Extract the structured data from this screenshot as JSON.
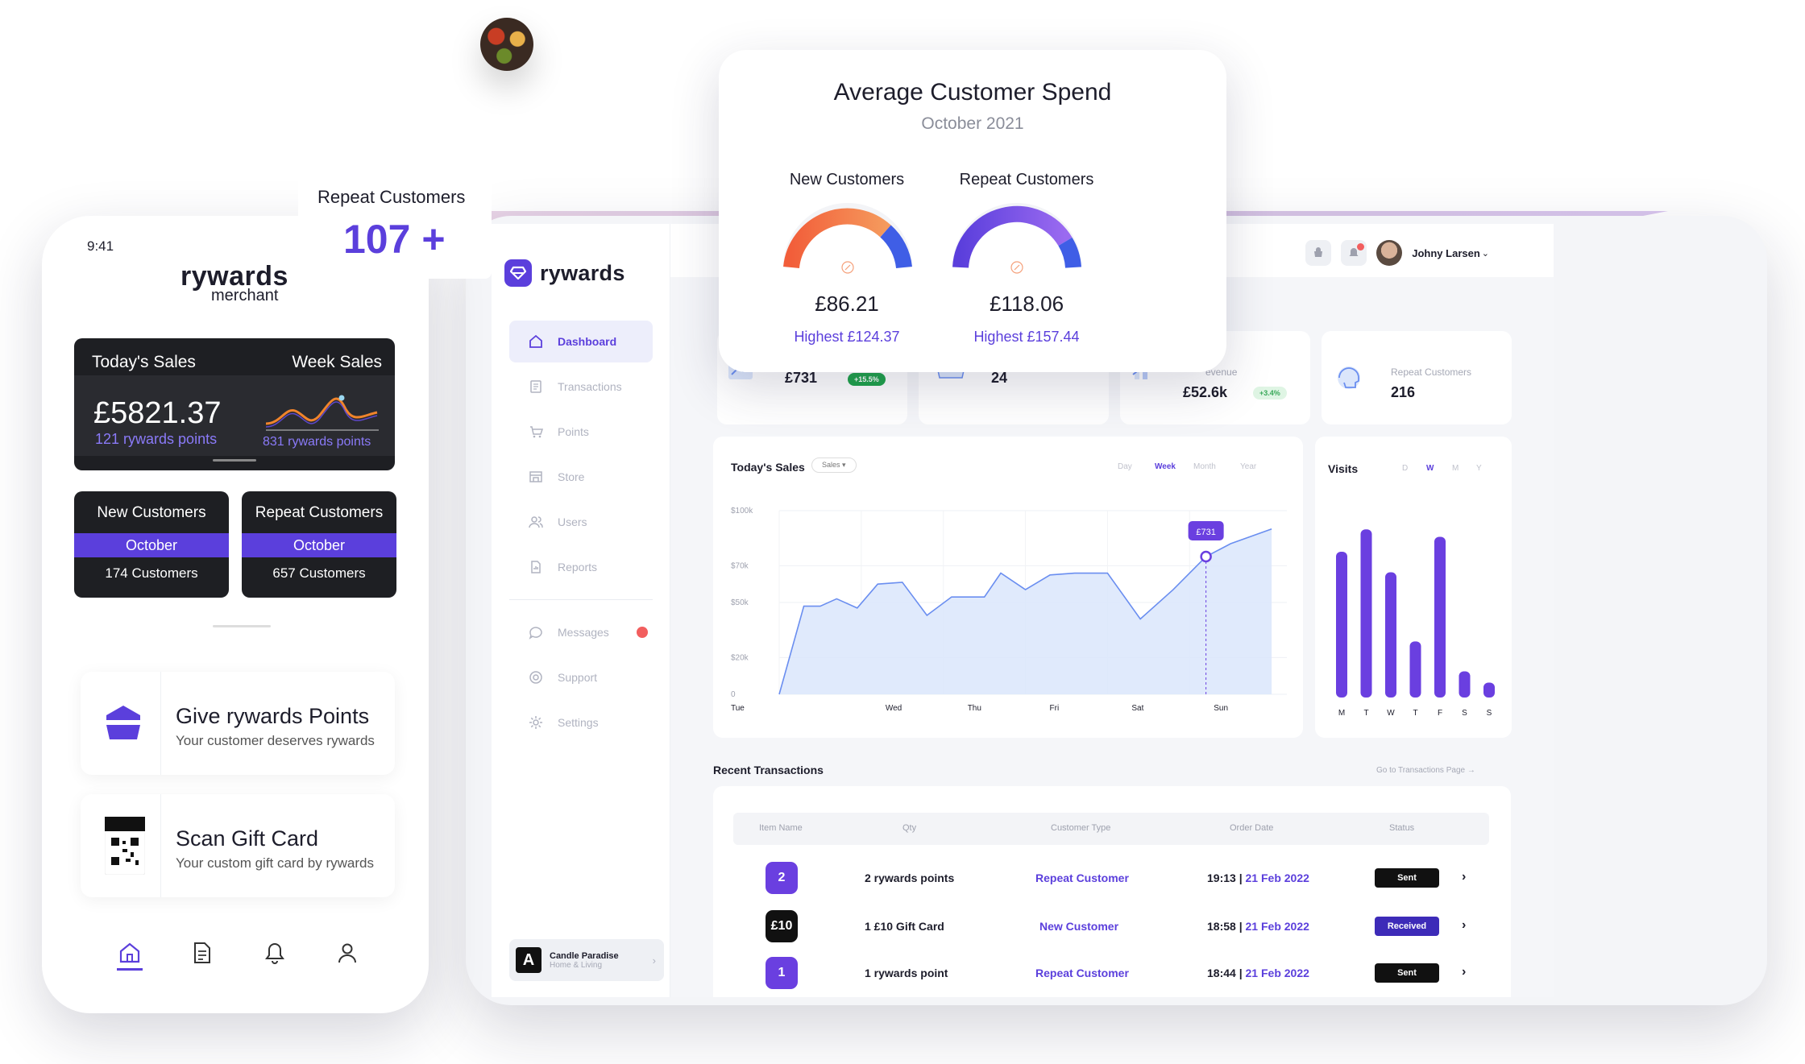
{
  "phone": {
    "time": "9:41",
    "brand": "rywards",
    "brand_sub": "merchant",
    "today_sales_label": "Today's Sales",
    "week_sales_label": "Week Sales",
    "today_sales_value": "£5821.37",
    "today_points": "121 rywards points",
    "week_points": "831 rywards points",
    "new_customers": {
      "title": "New Customers",
      "period": "October",
      "count": "174 Customers"
    },
    "repeat_customers": {
      "title": "Repeat Customers",
      "period": "October",
      "count": "657 Customers"
    },
    "give_points": {
      "title": "Give rywards Points",
      "subtitle": "Your customer deserves rywards"
    },
    "scan_gift": {
      "title": "Scan Gift Card",
      "subtitle": "Your custom gift card by rywards"
    },
    "tabbar": [
      "home-icon",
      "document-icon",
      "bell-icon",
      "profile-icon"
    ]
  },
  "repeat_badge": {
    "label": "Repeat Customers",
    "value": "107 +"
  },
  "popup": {
    "title": "Average Customer Spend",
    "subtitle": "October 2021",
    "new": {
      "label": "New Customers",
      "value": "£86.21",
      "highest_label": "Highest",
      "highest": "£124.37",
      "fraction": 0.7
    },
    "repeat": {
      "label": "Repeat Customers",
      "value": "£118.06",
      "highest_label": "Highest",
      "highest": "£157.44",
      "fraction": 0.75
    }
  },
  "dashboard": {
    "brand": "rywards",
    "nav": [
      {
        "label": "Dashboard",
        "icon": "home-icon",
        "active": true
      },
      {
        "label": "Transactions",
        "icon": "transactions-icon"
      },
      {
        "label": "Points",
        "icon": "cart-icon"
      },
      {
        "label": "Store",
        "icon": "store-icon"
      },
      {
        "label": "Users",
        "icon": "users-icon"
      },
      {
        "label": "Reports",
        "icon": "reports-icon"
      }
    ],
    "nav_secondary": [
      {
        "label": "Messages",
        "icon": "chat-icon",
        "dot": true
      },
      {
        "label": "Support",
        "icon": "support-icon"
      },
      {
        "label": "Settings",
        "icon": "gear-icon"
      }
    ],
    "store": {
      "name": "Candle Paradise",
      "category": "Home & Living",
      "logo": "A"
    },
    "user": "Johny Larsen",
    "kpis": [
      {
        "label": "",
        "value": "£731",
        "change": "+15.5%"
      },
      {
        "label": "",
        "value": "24"
      },
      {
        "label": "evenue",
        "value": "£52.6k",
        "change": "+3.4%"
      },
      {
        "label": "Repeat Customers",
        "value": "216"
      }
    ],
    "sales_chart": {
      "title": "Today's Sales",
      "dropdown": "Sales",
      "tabs": [
        "Day",
        "Week",
        "Month",
        "Year"
      ],
      "active_tab": "Week"
    },
    "visits": {
      "title": "Visits",
      "tabs": [
        "D",
        "W",
        "M",
        "Y"
      ],
      "active_tab": "W"
    },
    "transactions": {
      "title": "Recent Transactions",
      "link": "Go to Transactions Page",
      "headers": [
        "Item Name",
        "Qty",
        "Customer Type",
        "Order Date",
        "Status"
      ],
      "rows": [
        {
          "badge": "2",
          "qty": "2 rywards points",
          "type": "Repeat Customer",
          "time": "19:13",
          "date": "21 Feb 2022",
          "status": "Sent",
          "status_color": "#111111",
          "badge_color": "#6a3fe0"
        },
        {
          "badge": "£10",
          "qty": "1 £10 Gift Card",
          "type": "New Customer",
          "time": "18:58",
          "date": "21 Feb 2022",
          "status": "Received",
          "status_color": "#3d2bb8",
          "badge_color": "#111111"
        },
        {
          "badge": "1",
          "qty": "1 rywards point",
          "type": "Repeat Customer",
          "time": "18:44",
          "date": "21 Feb 2022",
          "status": "Sent",
          "status_color": "#111111",
          "badge_color": "#6a3fe0"
        }
      ]
    }
  },
  "chart_data": [
    {
      "type": "area",
      "title": "Today's Sales",
      "categories": [
        "Tue",
        "Wed",
        "Thu",
        "Fri",
        "Sat",
        "Sun"
      ],
      "ylabels": [
        "$100k",
        "$70k",
        "$50k",
        "$20k",
        "0"
      ],
      "ylim": [
        0,
        100000
      ],
      "x": [
        0,
        0.3,
        0.5,
        0.7,
        0.95,
        1.2,
        1.5,
        1.8,
        2.1,
        2.3,
        2.5,
        2.7,
        3.0,
        3.3,
        3.6,
        4.0,
        4.4,
        4.8,
        5.2,
        5.5,
        5.75,
        6.0
      ],
      "values": [
        0,
        48000,
        48000,
        52000,
        47000,
        60000,
        61000,
        43000,
        53000,
        53000,
        53000,
        66000,
        57000,
        65000,
        66000,
        66000,
        41000,
        57000,
        75000,
        82000,
        86000,
        90000
      ],
      "tooltip": {
        "label": "£731",
        "x": 5.2,
        "value": 75000
      },
      "colors": {
        "line": "#6a8ef0",
        "fill": "#dbe6fb",
        "point": "#6a3fe0"
      }
    },
    {
      "type": "bar",
      "title": "Visits",
      "categories": [
        "M",
        "T",
        "W",
        "T",
        "F",
        "S",
        "S"
      ],
      "values": [
        78,
        90,
        67,
        30,
        86,
        14,
        8
      ],
      "ylim": [
        0,
        100
      ],
      "colors": {
        "bar": "#6a3fe0"
      }
    }
  ]
}
